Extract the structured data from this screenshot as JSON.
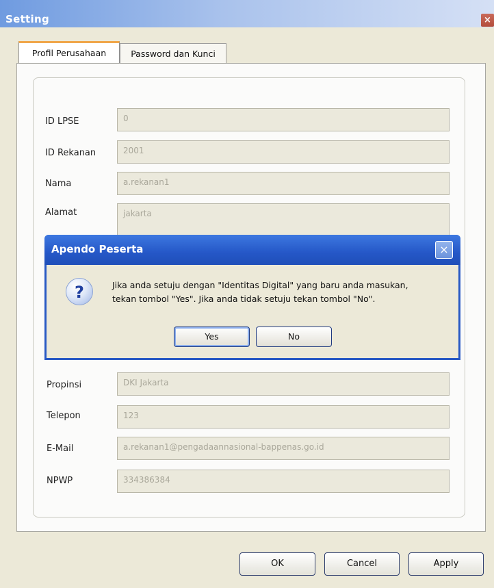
{
  "window": {
    "title": "Setting",
    "close_glyph": "×"
  },
  "tabs": [
    {
      "label": "Profil Perusahaan",
      "active": true
    },
    {
      "label": "Password dan Kunci",
      "active": false
    }
  ],
  "form": {
    "fields": [
      {
        "label": "ID LPSE",
        "value": "0"
      },
      {
        "label": "ID Rekanan",
        "value": "2001"
      },
      {
        "label": "Nama",
        "value": "a.rekanan1"
      },
      {
        "label": "Alamat",
        "value": "jakarta"
      },
      {
        "label": "Propinsi",
        "value": "DKI Jakarta"
      },
      {
        "label": "Telepon",
        "value": "123"
      },
      {
        "label": "E-Mail",
        "value": "a.rekanan1@pengadaannasional-bappenas.go.id"
      },
      {
        "label": "NPWP",
        "value": "334386384"
      }
    ]
  },
  "footer": {
    "ok": "OK",
    "cancel": "Cancel",
    "apply": "Apply"
  },
  "dialog": {
    "title": "Apendo Peserta",
    "close_glyph": "×",
    "icon": "question-icon",
    "icon_glyph": "?",
    "message_line1": "Jika anda setuju dengan \"Identitas Digital\" yang baru anda masukan,",
    "message_line2": "tekan tombol \"Yes\". Jika anda tidak setuju tekan tombol \"No\".",
    "yes": "Yes",
    "no": "No"
  },
  "colors": {
    "titlebar": "#6f9be0",
    "dialog_titlebar": "#2557c7",
    "tab_highlight": "#f0a64a",
    "window_bg": "#ece9d8"
  }
}
